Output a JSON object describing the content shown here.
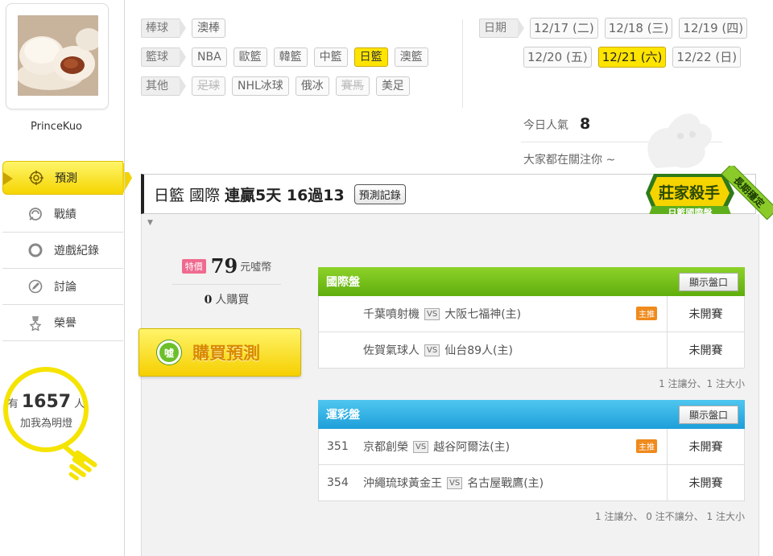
{
  "user": {
    "name": "PrinceKuo"
  },
  "nav": [
    {
      "label": "預測",
      "icon": "target-icon",
      "active": true
    },
    {
      "label": "戰績",
      "icon": "record-icon",
      "active": false
    },
    {
      "label": "遊戲紀錄",
      "icon": "circle-icon",
      "active": false
    },
    {
      "label": "討論",
      "icon": "edit-icon",
      "active": false
    },
    {
      "label": "榮譽",
      "icon": "medal-icon",
      "active": false
    }
  ],
  "fans": {
    "prefix": "有",
    "count": "1657",
    "suffix": "人",
    "sub": "加我為明燈"
  },
  "filters": {
    "baseball": {
      "label": "棒球",
      "items": [
        "澳棒"
      ]
    },
    "basketball": {
      "label": "籃球",
      "items": [
        "NBA",
        "歐籃",
        "韓籃",
        "中籃",
        "日籃",
        "澳籃"
      ],
      "selected": "日籃"
    },
    "other": {
      "label": "其他",
      "items": [
        "足球",
        "NHL冰球",
        "俄冰",
        "賽馬",
        "美足"
      ],
      "disabled": [
        "足球",
        "賽馬"
      ]
    },
    "date": {
      "label": "日期",
      "items": [
        "12/17 (二)",
        "12/18 (三)",
        "12/19 (四)",
        "12/20 (五)",
        "12/21 (六)",
        "12/22 (日)"
      ],
      "selected": "12/21 (六)"
    }
  },
  "popularity": {
    "label": "今日人氣",
    "value": "8"
  },
  "attention": "大家都在關注你 ~",
  "header": {
    "league": "日籃",
    "category": "國際",
    "streak": "連贏5天 16過13",
    "record_button": "預測記錄"
  },
  "badge": {
    "title": "莊家殺手",
    "subtitle": "日籃國際盤",
    "ribbon": "長期穩定"
  },
  "price": {
    "tag": "特價",
    "amount": "79",
    "unit": "元噓幣",
    "buyers": "0",
    "buyers_label": "人購買"
  },
  "buy_button": {
    "coin": "噓",
    "label": "購買預測"
  },
  "panels": [
    {
      "title": "國際盤",
      "button": "顯示盤口",
      "games": [
        {
          "no": "",
          "away": "千葉噴射機",
          "home": "大阪七福神(主)",
          "pin": "主推",
          "status": "未開賽"
        },
        {
          "no": "",
          "away": "佐賀氣球人",
          "home": "仙台89人(主)",
          "pin": "",
          "status": "未開賽"
        }
      ],
      "note": "1 注讓分、1 注大小"
    },
    {
      "title": "運彩盤",
      "button": "顯示盤口",
      "games": [
        {
          "no": "351",
          "away": "京都創榮",
          "home": "越谷阿爾法(主)",
          "pin": "主推",
          "status": "未開賽"
        },
        {
          "no": "354",
          "away": "沖繩琉球黃金王",
          "home": "名古屋戰鷹(主)",
          "pin": "",
          "status": "未開賽"
        }
      ],
      "note": "1 注讓分、 0 注不讓分、 1 注大小"
    }
  ],
  "vs_label": "VS",
  "colors": {
    "accent_yellow": "#ffe400",
    "green_panel": "#6fbe14",
    "blue_panel": "#2aaee3",
    "sale_pink": "#f06a8f",
    "pin_orange": "#ef8a1c"
  }
}
